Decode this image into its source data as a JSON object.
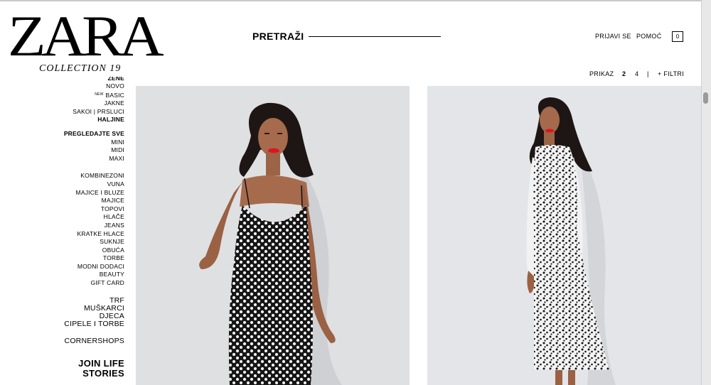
{
  "logo": {
    "brand": "ZARA",
    "collection": "COLLECTION 19"
  },
  "header": {
    "search_label": "PRETRAŽI",
    "login": "PRIJAVI SE",
    "help": "POMOĆ",
    "cart_count": "0",
    "cart_icon": "bag-icon"
  },
  "view_controls": {
    "label": "PRIKAZ",
    "option_2": "2",
    "option_4": "4",
    "separator": "|",
    "filters": "+ FILTRI"
  },
  "sidebar": {
    "cut_item": "ŽENE",
    "group1": [
      "NOVO",
      "BASIC",
      "JAKNE",
      "SAKOI | PRSLUCI",
      "HALJINE"
    ],
    "new_tag": "NEW",
    "subheader": "PREGLEDAJTE SVE",
    "group2": [
      "MINI",
      "MIDI",
      "MAXI"
    ],
    "group3": [
      "KOMBINEZONI",
      "VUNA",
      "MAJICE I BLUZE",
      "MAJICE",
      "TOPOVI",
      "HLAČE",
      "JEANS",
      "KRATKE HLACE",
      "SUKNJE",
      "OBUĆA",
      "TORBE",
      "MODNI DODACI",
      "BEAUTY",
      "GIFT CARD"
    ],
    "group4": [
      "TRF",
      "MUŠKARCI",
      "DJECA",
      "CIPELE I TORBE"
    ],
    "cornershops": "CORNERSHOPS",
    "join_life": "JOIN LIFE",
    "stories": "STORIES"
  },
  "products": [
    {
      "name": "product-image-polka-dot-slip-dress",
      "bg": "#dfe0e2"
    },
    {
      "name": "product-image-printed-midi-dress",
      "bg": "#e3e5e8"
    }
  ],
  "colors": {
    "text": "#000000",
    "background": "#ffffff",
    "lipstick": "#e0141e"
  }
}
